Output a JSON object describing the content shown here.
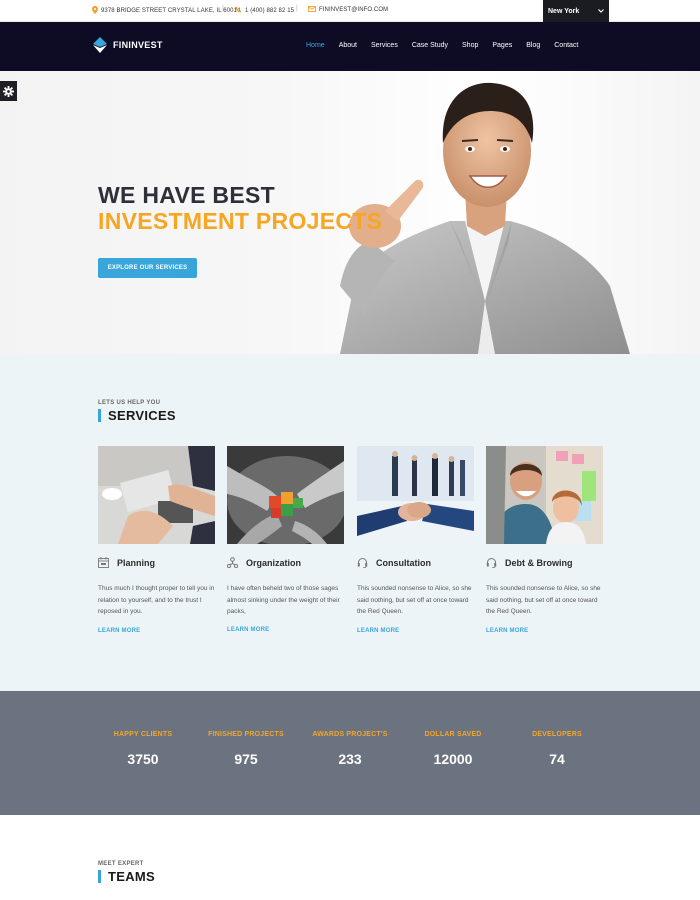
{
  "topbar": {
    "address": "9378 BRIDGE STREET CRYSTAL LAKE, IL 60014",
    "phone": "1 (400) 882 82 15",
    "email": "FININVEST@INFO.COM",
    "separator": "|",
    "city": "New York"
  },
  "header": {
    "brand": "FININVEST",
    "nav": [
      "Home",
      "About",
      "Services",
      "Case Study",
      "Shop",
      "Pages",
      "Blog",
      "Contact"
    ],
    "active_nav": "Home"
  },
  "hero": {
    "line1": "WE HAVE BEST",
    "line2": "INVESTMENT PROJECTS",
    "button": "EXPLORE OUR SERVICES"
  },
  "services": {
    "kicker": "LETS US HELP YOU",
    "title": "SERVICES",
    "items": [
      {
        "title": "Planning",
        "icon": "calendar-icon",
        "desc": "Thus much I thought proper to tell you in relation to yourself, and to the trust I reposed in you.",
        "link": "LEARN MORE"
      },
      {
        "title": "Organization",
        "icon": "network-icon",
        "desc": "I have often beheld two of those sages almost sinking under the weight of their packs,",
        "link": "LEARN MORE"
      },
      {
        "title": "Consultation",
        "icon": "headset-icon",
        "desc": "This sounded nonsense to Alice, so she said nothing, but set off at once toward the Red Queen.",
        "link": "LEARN MORE"
      },
      {
        "title": "Debt & Browing",
        "icon": "headset-icon",
        "desc": "This sounded nonsense to Alice, so she said nothing, but set off at once toward the Red Queen.",
        "link": "LEARN MORE"
      }
    ]
  },
  "stats": [
    {
      "label": "HAPPY CLIENTS",
      "value": "3750"
    },
    {
      "label": "FINISHED PROJECTS",
      "value": "975"
    },
    {
      "label": "AWARDS PROJECT'S",
      "value": "233"
    },
    {
      "label": "DOLLAR SAVED",
      "value": "12000"
    },
    {
      "label": "DEVELOPERS",
      "value": "74"
    }
  ],
  "teams": {
    "kicker": "MEET EXPERT",
    "title": "TEAMS"
  },
  "colors": {
    "accent_blue": "#38a6db",
    "accent_orange": "#f5a623",
    "header_bg": "#0d0c24",
    "stats_bg": "#6b7380"
  }
}
